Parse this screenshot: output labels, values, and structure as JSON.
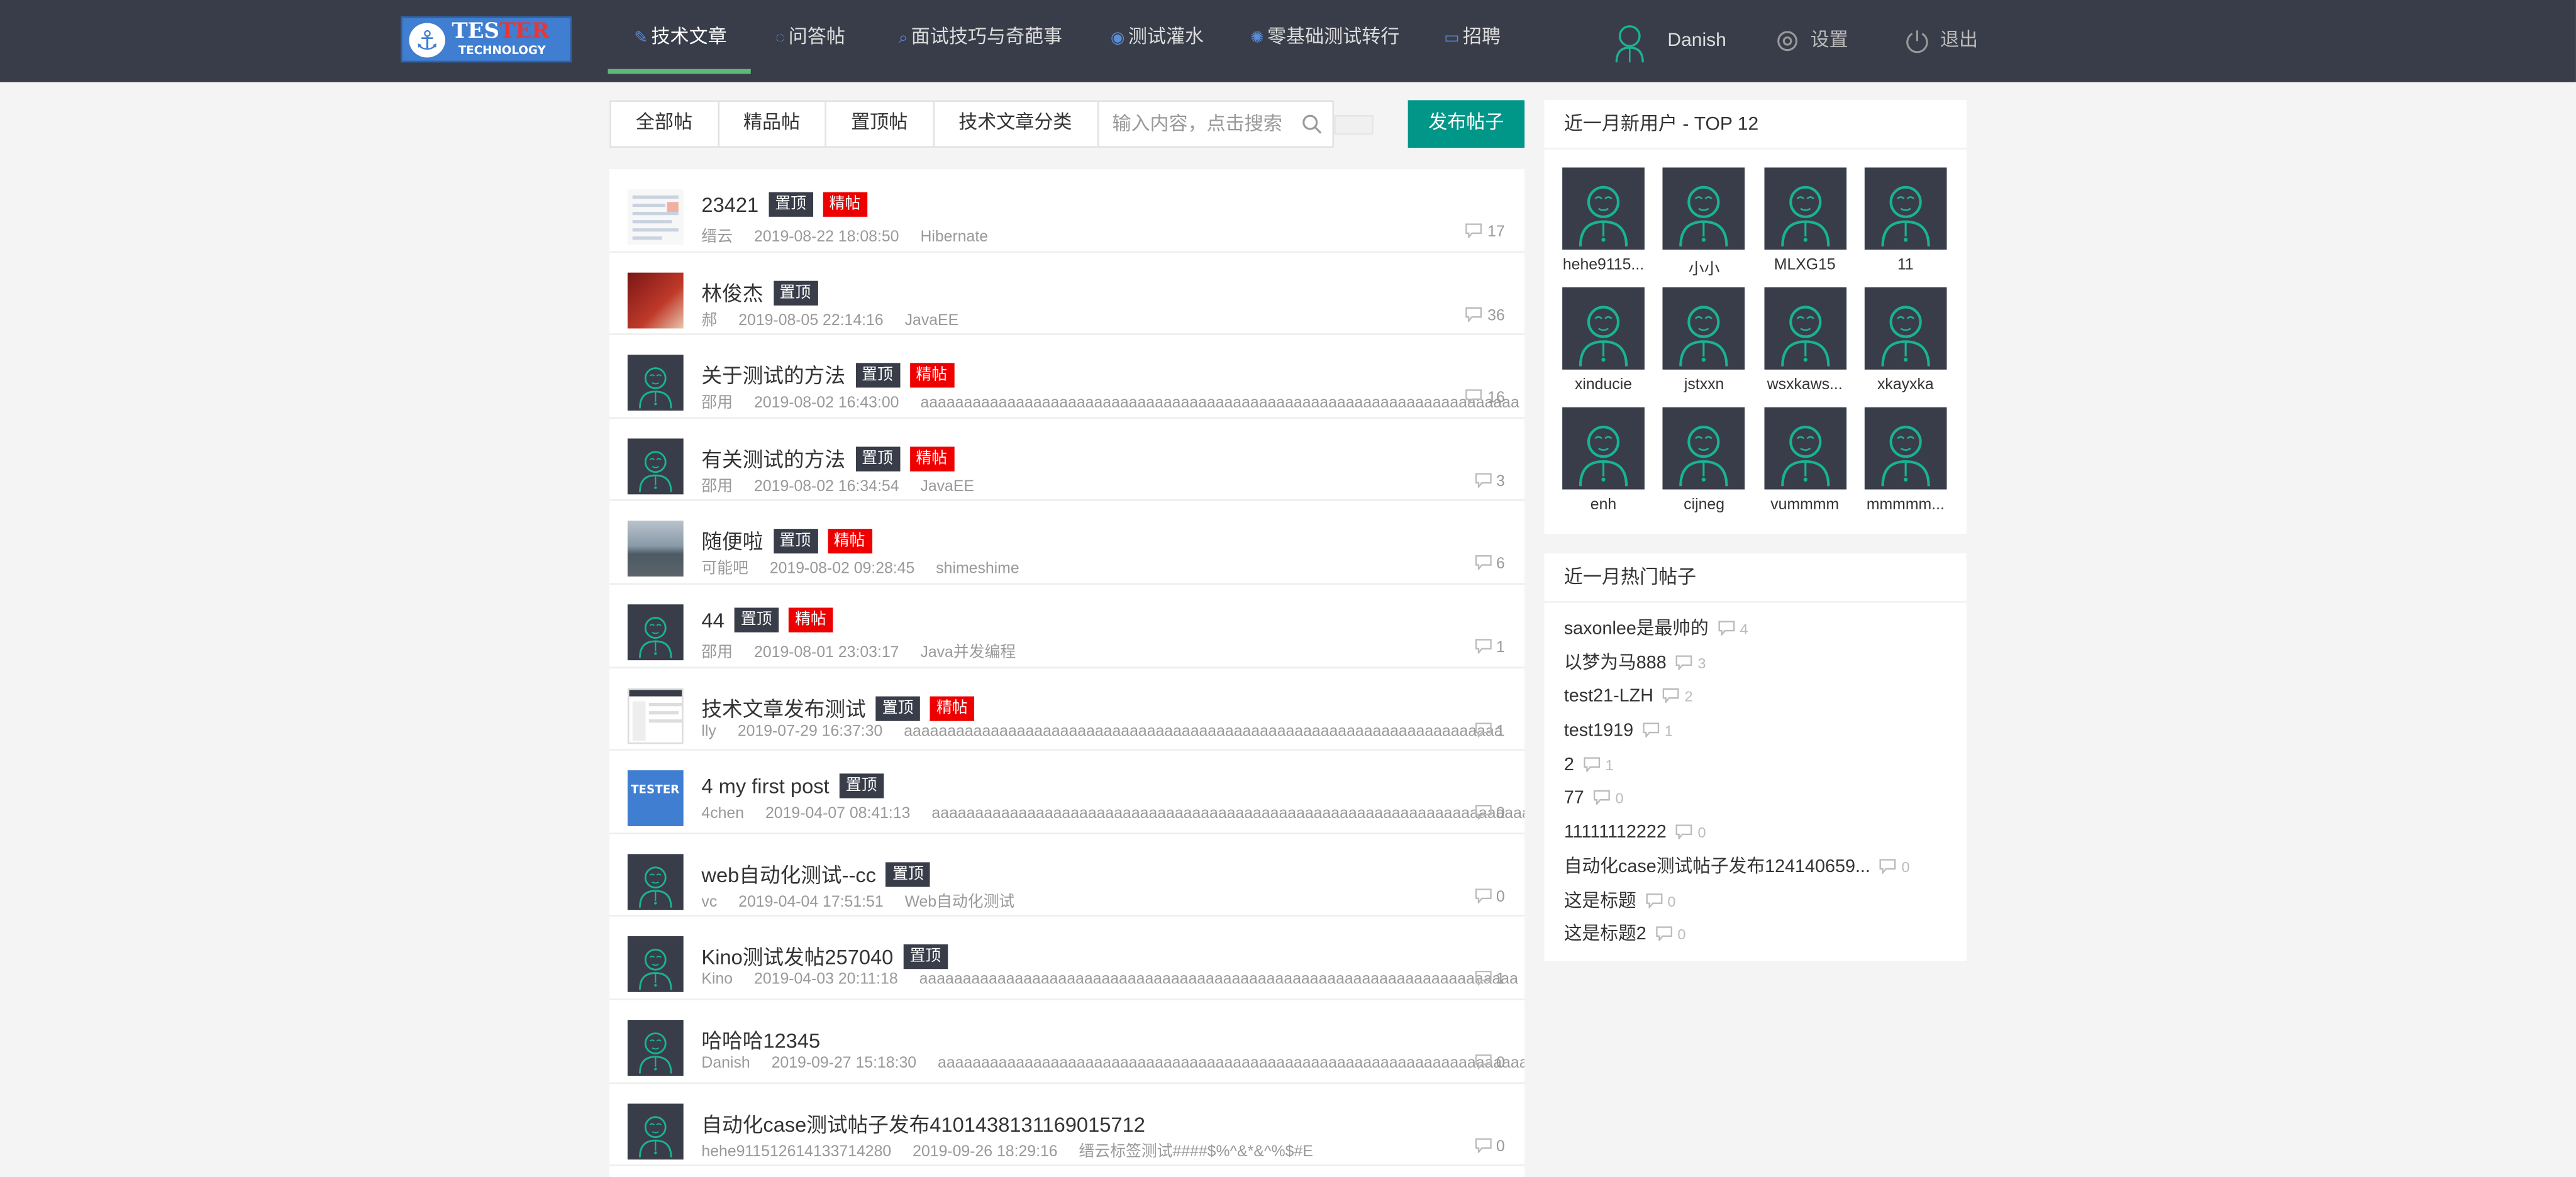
{
  "logo": {
    "brand_a": "TES",
    "brand_b": "TER",
    "tagline": "TECHNOLOGY"
  },
  "nav": {
    "items": [
      {
        "label": "技术文章",
        "icon": "pencil-icon"
      },
      {
        "label": "问答帖",
        "icon": "question-icon"
      },
      {
        "label": "面试技巧与奇葩事",
        "icon": "search-icon"
      },
      {
        "label": "测试灌水",
        "icon": "water-icon"
      },
      {
        "label": "零基础测试转行",
        "icon": "compass-icon"
      },
      {
        "label": "招聘",
        "icon": "briefcase-icon"
      }
    ],
    "active": "技术文章",
    "user": "Danish",
    "settings": "设置",
    "logout": "退出"
  },
  "filter": {
    "tabs": [
      "全部帖",
      "精品帖",
      "置顶帖",
      "技术文章分类"
    ],
    "search_placeholder": "输入内容，点击搜索",
    "publish": "发布帖子"
  },
  "badges": {
    "top": "置顶",
    "best": "精帖"
  },
  "posts": [
    {
      "title": "23421",
      "top": true,
      "best": true,
      "author": "缙云",
      "date": "2019-08-22 18:08:50",
      "tag": "Hibernate",
      "comments": "17",
      "thumb": "photo-grid"
    },
    {
      "title": "林俊杰",
      "top": true,
      "best": false,
      "author": "郝",
      "date": "2019-08-05 22:14:16",
      "tag": "JavaEE",
      "comments": "36",
      "thumb": "photo-red"
    },
    {
      "title": "关于测试的方法",
      "top": true,
      "best": true,
      "author": "邵用",
      "date": "2019-08-02 16:43:00",
      "tag": "aaaaaaaaaaaaaaaaaaaaaaaaaaaaaaaaaaaaaaaaaaaaaaaaaaaaaaaaaaaaaaaaaaaaa",
      "comments": "16",
      "thumb": "avatar"
    },
    {
      "title": "有关测试的方法",
      "top": true,
      "best": true,
      "author": "邵用",
      "date": "2019-08-02 16:34:54",
      "tag": "JavaEE",
      "comments": "3",
      "thumb": "avatar"
    },
    {
      "title": "随便啦",
      "top": true,
      "best": true,
      "author": "可能吧",
      "date": "2019-08-02 09:28:45",
      "tag": "shimeshime",
      "comments": "6",
      "thumb": "photo-sea"
    },
    {
      "title": "44",
      "top": true,
      "best": true,
      "author": "邵用",
      "date": "2019-08-01 23:03:17",
      "tag": "Java并发编程",
      "comments": "1",
      "thumb": "avatar"
    },
    {
      "title": "技术文章发布测试",
      "top": true,
      "best": true,
      "author": "lly",
      "date": "2019-07-29 16:37:30",
      "tag": "aaaaaaaaaaaaaaaaaaaaaaaaaaaaaaaaaaaaaaaaaaaaaaaaaaaaaaaaaaaaaaaaaaaaa",
      "comments": "1",
      "thumb": "photo-screen"
    },
    {
      "title": "4 my first post",
      "top": true,
      "best": false,
      "author": "4chen",
      "date": "2019-04-07 08:41:13",
      "tag": "aaaaaaaaaaaaaaaaaaaaaaaaaaaaaaaaaaaaaaaaaaaaaaaaaaaaaaaaaaaaaaaaaaaaa",
      "comments": "0",
      "thumb": "photo-logo"
    },
    {
      "title": "web自动化测试--cc",
      "top": true,
      "best": false,
      "author": "vc",
      "date": "2019-04-04 17:51:51",
      "tag": "Web自动化测试",
      "comments": "0",
      "thumb": "avatar"
    },
    {
      "title": "Kino测试发帖257040",
      "top": true,
      "best": false,
      "author": "Kino",
      "date": "2019-04-03 20:11:18",
      "tag": "aaaaaaaaaaaaaaaaaaaaaaaaaaaaaaaaaaaaaaaaaaaaaaaaaaaaaaaaaaaaaaaaaaaaa",
      "comments": "1",
      "thumb": "avatar"
    },
    {
      "title": "哈哈哈12345",
      "top": false,
      "best": false,
      "author": "Danish",
      "date": "2019-09-27 15:18:30",
      "tag": "aaaaaaaaaaaaaaaaaaaaaaaaaaaaaaaaaaaaaaaaaaaaaaaaaaaaaaaaaaaaaaaaaaaaa",
      "comments": "0",
      "thumb": "avatar"
    },
    {
      "title": "自动化case测试帖子发布4101438131169015712",
      "top": false,
      "best": false,
      "author": "hehe911512614133714280",
      "date": "2019-09-26 18:29:16",
      "tag": "缙云标签测试####$%^&*&^%$#E",
      "comments": "0",
      "thumb": "avatar"
    }
  ],
  "new_users": {
    "title": "近一月新用户 - TOP 12",
    "users": [
      "hehe9115...",
      "小小",
      "MLXG15",
      "11",
      "xinducie",
      "jstxxn",
      "wsxkaws...",
      "xkayxka",
      "enh",
      "cijneg",
      "vummmm",
      "mmmmm..."
    ]
  },
  "hot_posts": {
    "title": "近一月热门帖子",
    "items": [
      {
        "title": "saxonlee是最帅的",
        "count": "4"
      },
      {
        "title": "以梦为马888",
        "count": "3"
      },
      {
        "title": "test21-LZH",
        "count": "2"
      },
      {
        "title": "test1919",
        "count": "1"
      },
      {
        "title": "2",
        "count": "1"
      },
      {
        "title": "77",
        "count": "0"
      },
      {
        "title": "11111112222",
        "count": "0"
      },
      {
        "title": "自动化case测试帖子发布124140659...",
        "count": "0"
      },
      {
        "title": "这是标题",
        "count": "0"
      },
      {
        "title": "这是标题2",
        "count": "0"
      }
    ]
  }
}
